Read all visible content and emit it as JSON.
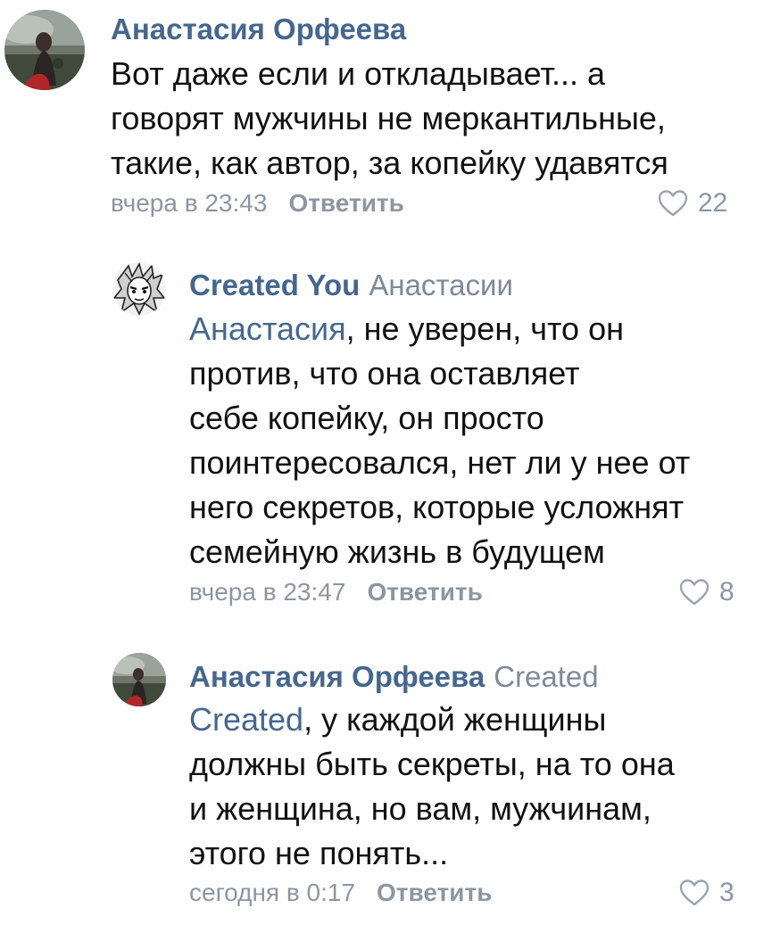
{
  "comments": [
    {
      "author": "Анастасия Орфеева",
      "reply_to": "",
      "mention": "",
      "mention_rest": "",
      "lines": [
        "Вот даже если и откладывает... а",
        "говорят мужчины не меркантильные,",
        "такие, как автор, за копейку удавятся"
      ],
      "time": "вчера в 23:43",
      "reply_label": "Ответить",
      "likes": "22",
      "avatar_icon": "user-photo-avatar"
    },
    {
      "author": "Created You",
      "reply_to": "Анастасии",
      "mention": "Анастасия",
      "mention_rest": ", не уверен, что он",
      "lines": [
        "против, что она оставляет",
        "себе копейку, он просто",
        "поинтересовался, нет ли у нее от",
        "него секретов, которые усложнят",
        "семейную жизнь в будущем"
      ],
      "time": "вчера в 23:47",
      "reply_label": "Ответить",
      "likes": "8",
      "avatar_icon": "anime-drawing-avatar"
    },
    {
      "author": "Анастасия Орфеева",
      "reply_to": "Created",
      "mention": "Created",
      "mention_rest": ", у каждой женщины",
      "lines": [
        "должны быть секреты, на то она",
        "и женщина, но вам, мужчинам,",
        "этого не понять..."
      ],
      "time": "сегодня в 0:17",
      "reply_label": "Ответить",
      "likes": "3",
      "avatar_icon": "user-photo-avatar"
    }
  ],
  "colors": {
    "author": "#45678f",
    "mention": "#45678f",
    "meta": "#8c96a1",
    "text": "#111111"
  }
}
